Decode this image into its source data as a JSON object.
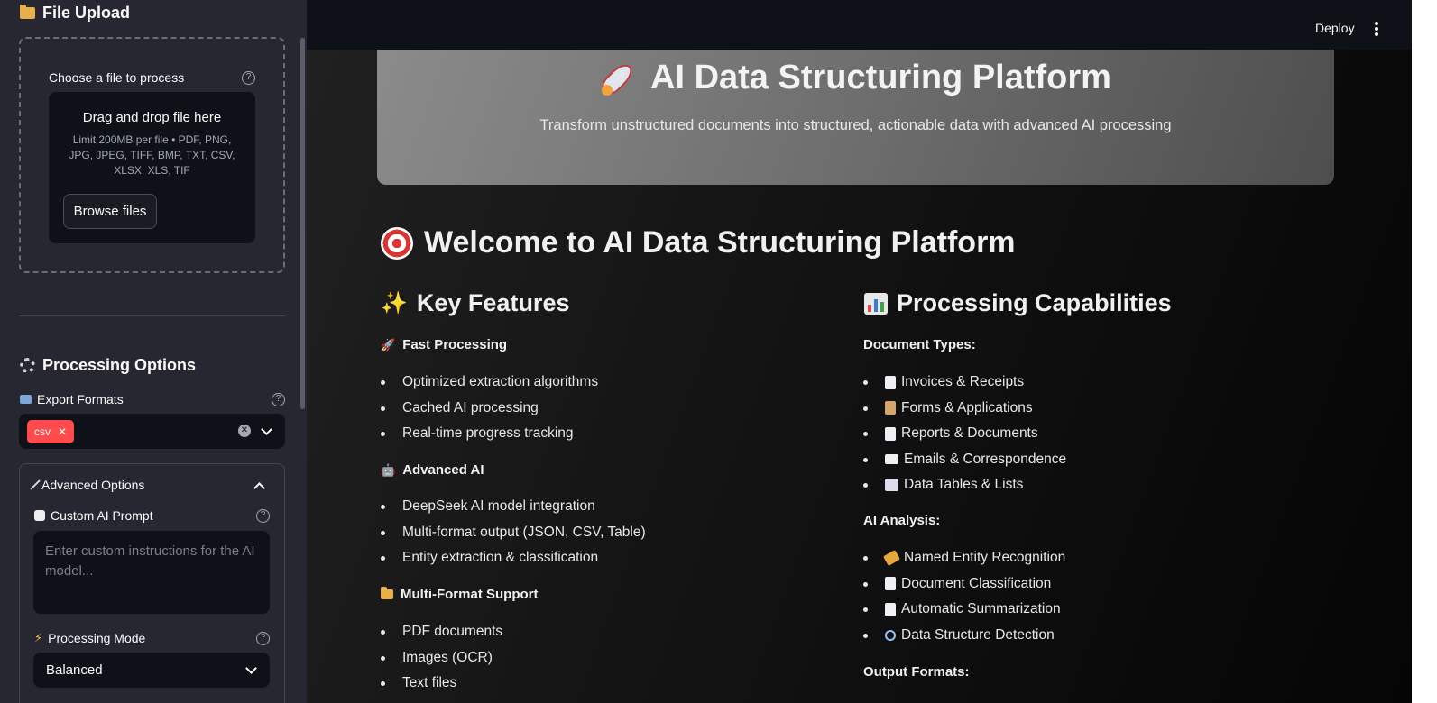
{
  "sidebar": {
    "file_upload_title": "File Upload",
    "uploader_label": "Choose a file to process",
    "dropzone_title": "Drag and drop file here",
    "dropzone_limit": "Limit 200MB per file • PDF, PNG, JPG, JPEG, TIFF, BMP, TXT, CSV, XLSX, XLS, TIF",
    "browse_label": "Browse files",
    "processing_options_title": "Processing Options",
    "export_formats_label": "Export Formats",
    "export_selected": [
      "csv"
    ],
    "advanced_options_label": "Advanced Options",
    "custom_prompt_label": "Custom AI Prompt",
    "custom_prompt_placeholder": "Enter custom instructions for the AI model...",
    "processing_mode_label": "Processing Mode",
    "processing_mode_value": "Balanced"
  },
  "header": {
    "deploy_label": "Deploy"
  },
  "hero": {
    "title": "AI Data Structuring Platform",
    "subtitle": "Transform unstructured documents into structured, actionable data with advanced AI processing"
  },
  "main": {
    "welcome_title": "Welcome to AI Data Structuring Platform",
    "key_features_title": "Key Features",
    "fast_processing_title": "Fast Processing",
    "fast_processing_items": [
      "Optimized extraction algorithms",
      "Cached AI processing",
      "Real-time progress tracking"
    ],
    "advanced_ai_title": "Advanced AI",
    "advanced_ai_items": [
      "DeepSeek AI model integration",
      "Multi-format output (JSON, CSV, Table)",
      "Entity extraction & classification"
    ],
    "multi_format_title": "Multi-Format Support",
    "multi_format_items": [
      "PDF documents",
      "Images (OCR)",
      "Text files"
    ],
    "capabilities_title": "Processing Capabilities",
    "document_types_title": "Document Types:",
    "document_types_items": [
      "Invoices & Receipts",
      "Forms & Applications",
      "Reports & Documents",
      "Emails & Correspondence",
      "Data Tables & Lists"
    ],
    "ai_analysis_title": "AI Analysis:",
    "ai_analysis_items": [
      "Named Entity Recognition",
      "Document Classification",
      "Automatic Summarization",
      "Data Structure Detection"
    ],
    "output_formats_title": "Output Formats:"
  },
  "colors": {
    "accent": "#ff4b4b",
    "sidebar_bg": "#262730",
    "app_bg": "#0e1117"
  }
}
